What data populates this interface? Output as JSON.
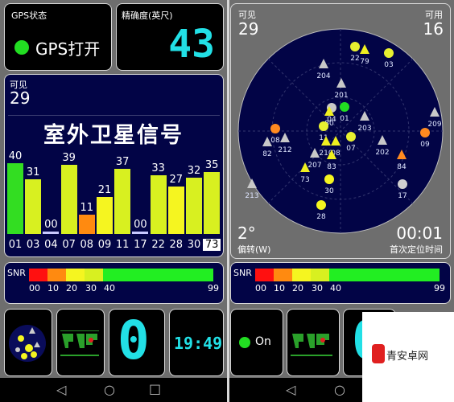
{
  "left": {
    "gps_status": {
      "label": "GPS状态",
      "value": "GPS打开",
      "indicator_color": "#22dd22"
    },
    "accuracy": {
      "label": "精确度(英尺)",
      "value": "43"
    },
    "visible": {
      "label": "可见",
      "value": "29"
    },
    "usable": {
      "label": "可用",
      "value": "16"
    },
    "title": "室外卫星信号",
    "bars": [
      {
        "id": "01",
        "snr": "40",
        "color": "#33dd22"
      },
      {
        "id": "03",
        "snr": "31",
        "color": "#d8f020"
      },
      {
        "id": "04",
        "snr": "00",
        "color": "#c8c8ff"
      },
      {
        "id": "07",
        "snr": "39",
        "color": "#d8f020"
      },
      {
        "id": "08",
        "snr": "11",
        "color": "#ff8a10"
      },
      {
        "id": "09",
        "snr": "21",
        "color": "#f5f520"
      },
      {
        "id": "11",
        "snr": "37",
        "color": "#d8f020"
      },
      {
        "id": "17",
        "snr": "00",
        "color": "#c8c8ff"
      },
      {
        "id": "22",
        "snr": "33",
        "color": "#d8f020"
      },
      {
        "id": "28",
        "snr": "27",
        "color": "#f5f520"
      },
      {
        "id": "30",
        "snr": "32",
        "color": "#d8f020"
      },
      {
        "id": "73",
        "snr": "35",
        "color": "#d8f020",
        "selected": true
      }
    ],
    "clock": "19:49",
    "digit": "0"
  },
  "snr_legend": {
    "label": "SNR",
    "ticks": [
      "00",
      "10",
      "20",
      "30",
      "40",
      "99"
    ],
    "colors": [
      "#ff1010",
      "#ff8a10",
      "#f5f520",
      "#d8f020",
      "#22ee22"
    ]
  },
  "right": {
    "visible": {
      "label": "可见",
      "value": "29"
    },
    "usable": {
      "label": "可用",
      "value": "16"
    },
    "declination": {
      "value": "2°",
      "label": "偏转(W)"
    },
    "ttff": {
      "value": "00:01",
      "label": "首次定位时间"
    },
    "satellites": [
      {
        "id": "22",
        "shape": "circle",
        "color": "#e8f030"
      },
      {
        "id": "79",
        "shape": "triangle",
        "color": "#f0f020"
      },
      {
        "id": "03",
        "shape": "circle",
        "color": "#e8f030"
      },
      {
        "id": "204",
        "shape": "triangle",
        "color": "#c8c8c8"
      },
      {
        "id": "201",
        "shape": "triangle",
        "color": "#c8c8c8"
      },
      {
        "id": "04",
        "shape": "circle",
        "color": "#c8c8c8"
      },
      {
        "id": "80",
        "shape": "triangle",
        "color": "#f0f020"
      },
      {
        "id": "01",
        "shape": "circle",
        "color": "#22dd22"
      },
      {
        "id": "203",
        "shape": "triangle",
        "color": "#c8c8c8"
      },
      {
        "id": "209",
        "shape": "triangle",
        "color": "#c8c8c8"
      },
      {
        "id": "11",
        "shape": "circle",
        "color": "#e8f030"
      },
      {
        "id": "08",
        "shape": "circle",
        "color": "#ff8a20"
      },
      {
        "id": "212",
        "shape": "triangle",
        "color": "#c8c8c8"
      },
      {
        "id": "82",
        "shape": "triangle",
        "color": "#c8c8c8"
      },
      {
        "id": "210",
        "shape": "triangle",
        "color": "#f0f020"
      },
      {
        "id": "08",
        "shape": "triangle",
        "color": "#f0f020"
      },
      {
        "id": "07",
        "shape": "circle",
        "color": "#e8f030"
      },
      {
        "id": "202",
        "shape": "triangle",
        "color": "#c8c8c8"
      },
      {
        "id": "09",
        "shape": "circle",
        "color": "#ff8a20"
      },
      {
        "id": "84",
        "shape": "triangle",
        "color": "#ff8a20"
      },
      {
        "id": "207",
        "shape": "triangle",
        "color": "#c8c8c8"
      },
      {
        "id": "83",
        "shape": "triangle",
        "color": "#f0f020"
      },
      {
        "id": "73",
        "shape": "triangle",
        "color": "#f0f020"
      },
      {
        "id": "30",
        "shape": "circle",
        "color": "#f5f520"
      },
      {
        "id": "17",
        "shape": "circle",
        "color": "#d0d0d0"
      },
      {
        "id": "213",
        "shape": "triangle",
        "color": "#c8c8c8"
      },
      {
        "id": "28",
        "shape": "circle",
        "color": "#f5f520"
      }
    ],
    "on_label": "On"
  },
  "watermark": "青安卓网"
}
